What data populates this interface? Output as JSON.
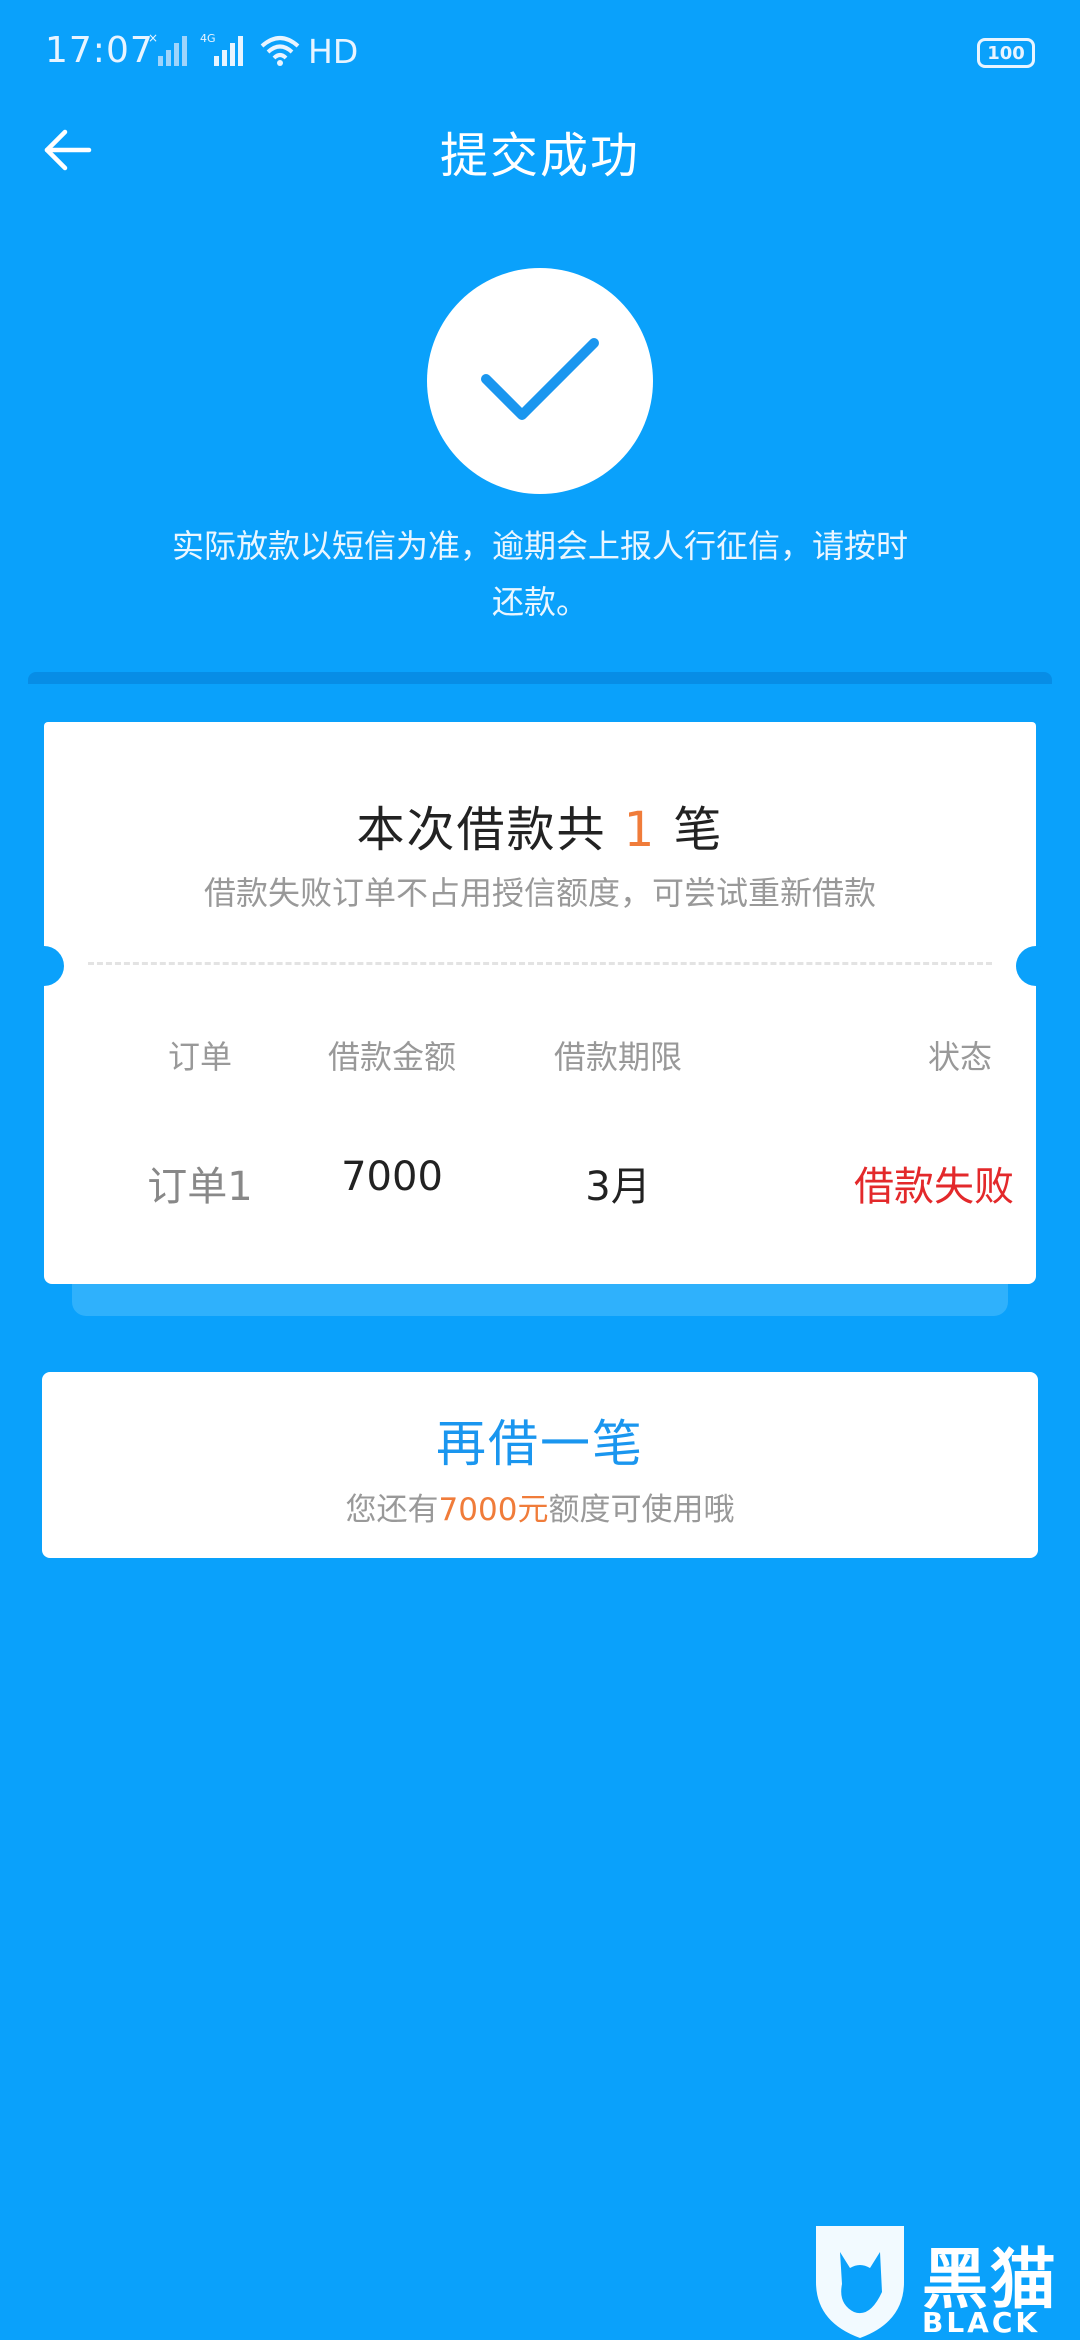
{
  "status_bar": {
    "time": "17:07",
    "network": "4G",
    "hd_label": "HD",
    "battery": "100"
  },
  "header": {
    "title": "提交成功"
  },
  "success": {
    "notice": "实际放款以短信为准，逾期会上报人行征信，请按时还款。"
  },
  "summary_card": {
    "title_prefix": "本次借款共",
    "count": "1",
    "title_suffix": "笔",
    "subtitle": "借款失败订单不占用授信额度，可尝试重新借款",
    "columns": [
      "订单",
      "借款金额",
      "借款期限",
      "状态"
    ],
    "rows": [
      {
        "order": "订单1",
        "amount": "7000",
        "term": "3月",
        "status": "借款失败"
      }
    ]
  },
  "borrow_again": {
    "title": "再借一笔",
    "sub_prefix": "您还有",
    "amount": "7000元",
    "sub_suffix": "额度可使用哦"
  },
  "watermark": {
    "text": "黑猫",
    "sub": "BLACK CAT"
  },
  "colors": {
    "background": "#0aa1fb",
    "accent_orange": "#f07c3a",
    "status_fail": "#e3292b",
    "link_blue": "#1a96ef"
  }
}
